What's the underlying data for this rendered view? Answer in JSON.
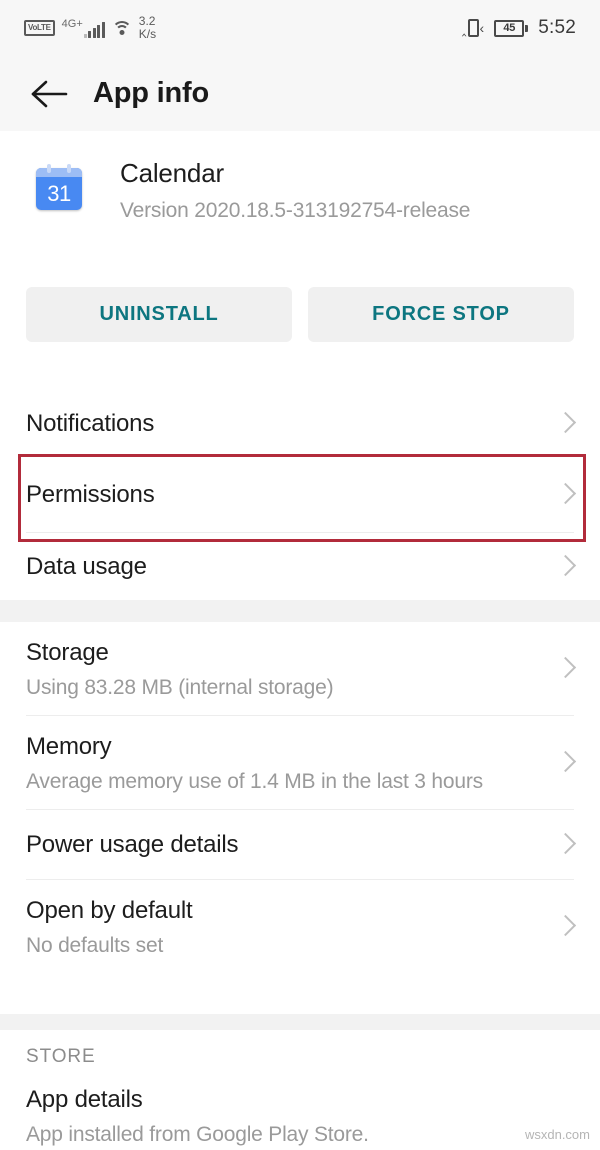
{
  "status_bar": {
    "volte_label": "VoLTE",
    "network_label": "4G+",
    "signal_bars": 5,
    "wifi_icon": "wifi-icon",
    "data_rate_value": "3.2",
    "data_rate_unit": "K/s",
    "vibrate_icon": "vibrate-icon",
    "battery_percent": "45",
    "time": "5:52"
  },
  "app_bar": {
    "back_icon": "back-arrow-icon",
    "title": "App info"
  },
  "app": {
    "icon_label": "31",
    "name": "Calendar",
    "version": "Version 2020.18.5-313192754-release"
  },
  "actions": {
    "uninstall_label": "UNINSTALL",
    "force_stop_label": "FORCE STOP",
    "accent_color": "#0d7680"
  },
  "sections": [
    {
      "id": "permissions-group",
      "rows": [
        {
          "id": "notifications",
          "title": "Notifications",
          "sub": ""
        },
        {
          "id": "permissions",
          "title": "Permissions",
          "sub": ""
        },
        {
          "id": "data-usage",
          "title": "Data usage",
          "sub": ""
        }
      ]
    },
    {
      "id": "usage-group",
      "rows": [
        {
          "id": "storage",
          "title": "Storage",
          "sub": "Using 83.28 MB (internal storage)"
        },
        {
          "id": "memory",
          "title": "Memory",
          "sub": "Average memory use of 1.4 MB in the last 3 hours"
        },
        {
          "id": "power-usage-details",
          "title": "Power usage details",
          "sub": ""
        },
        {
          "id": "open-by-default",
          "title": "Open by default",
          "sub": "No defaults set"
        }
      ]
    },
    {
      "id": "store-group",
      "header": "STORE",
      "rows": [
        {
          "id": "app-details",
          "title": "App details",
          "sub": "App installed from Google Play Store."
        }
      ]
    }
  ],
  "annotation": {
    "target": "permissions",
    "color": "#b22b3b"
  },
  "watermark": "wsxdn.com"
}
